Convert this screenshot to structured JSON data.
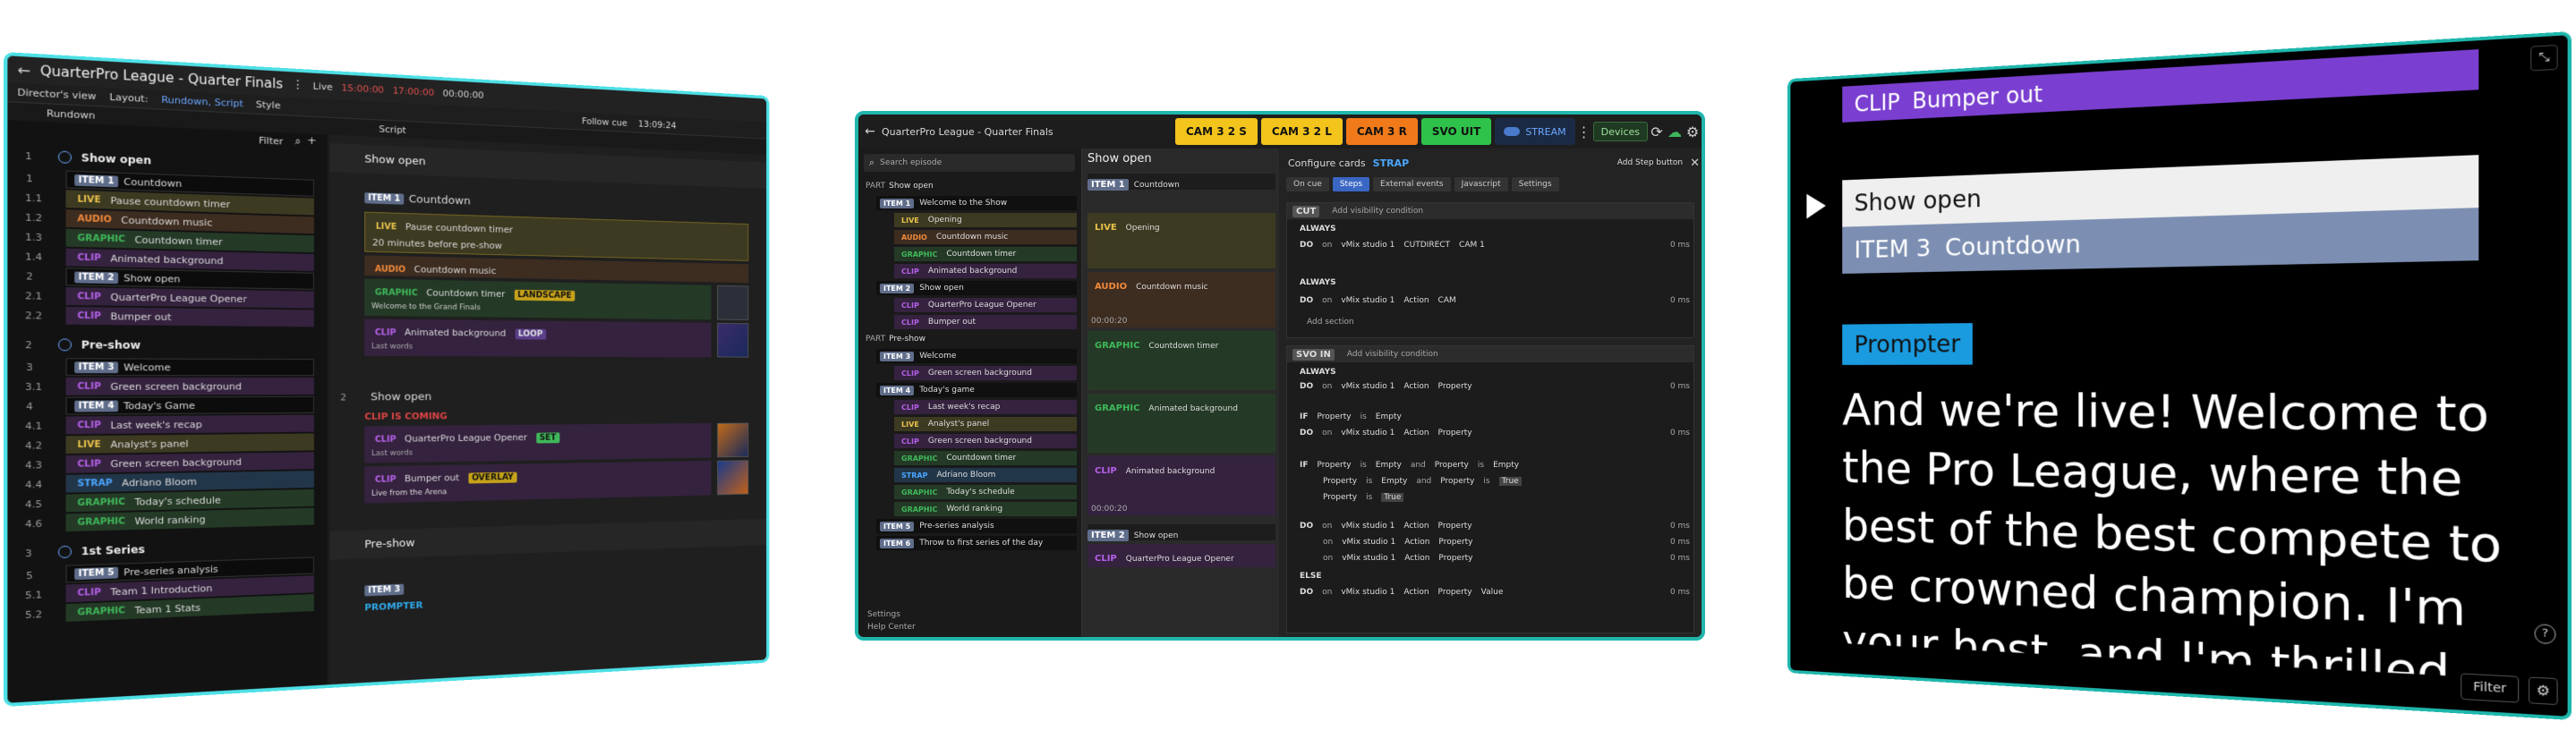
{
  "left": {
    "title": "QuarterPro League - Quarter Finals",
    "view_label": "Director's view",
    "layout_label": "Layout:",
    "layout_value": "Rundown, Script",
    "style_label": "Style",
    "live_label": "Live",
    "time1": "15:00:00",
    "time2": "17:00:00",
    "time3": "00:00:00",
    "rundown_tab": "Rundown",
    "script_tab": "Script",
    "filter_label": "Filter",
    "follow_label": "Follow cue",
    "clock": "13:09:24",
    "rundown": [
      {
        "num": "1",
        "kind": "part",
        "label": "Show open"
      },
      {
        "num": "1",
        "kind": "item",
        "tag": "ITEM 1",
        "label": "Countdown"
      },
      {
        "num": "1.1",
        "kind": "live",
        "tag": "LIVE",
        "label": "Pause countdown timer"
      },
      {
        "num": "1.2",
        "kind": "audio",
        "tag": "AUDIO",
        "label": "Countdown music"
      },
      {
        "num": "1.3",
        "kind": "graphic",
        "tag": "GRAPHIC",
        "label": "Countdown timer"
      },
      {
        "num": "1.4",
        "kind": "clip",
        "tag": "CLIP",
        "label": "Animated background"
      },
      {
        "num": "2",
        "kind": "item",
        "tag": "ITEM 2",
        "label": "Show open"
      },
      {
        "num": "2.1",
        "kind": "clip",
        "tag": "CLIP",
        "label": "QuarterPro League Opener"
      },
      {
        "num": "2.2",
        "kind": "clip",
        "tag": "CLIP",
        "label": "Bumper out"
      },
      {
        "num": "2",
        "kind": "part",
        "label": "Pre-show"
      },
      {
        "num": "3",
        "kind": "item",
        "tag": "ITEM 3",
        "label": "Welcome"
      },
      {
        "num": "3.1",
        "kind": "clip",
        "tag": "CLIP",
        "label": "Green screen background"
      },
      {
        "num": "4",
        "kind": "item",
        "tag": "ITEM 4",
        "label": "Today's Game"
      },
      {
        "num": "4.1",
        "kind": "clip",
        "tag": "CLIP",
        "label": "Last week's recap"
      },
      {
        "num": "4.2",
        "kind": "live",
        "tag": "LIVE",
        "label": "Analyst's panel"
      },
      {
        "num": "4.3",
        "kind": "clip",
        "tag": "CLIP",
        "label": "Green screen background"
      },
      {
        "num": "4.4",
        "kind": "strap",
        "tag": "STRAP",
        "label": "Adriano Bloom"
      },
      {
        "num": "4.5",
        "kind": "graphic",
        "tag": "GRAPHIC",
        "label": "Today's schedule"
      },
      {
        "num": "4.6",
        "kind": "graphic",
        "tag": "GRAPHIC",
        "label": "World ranking"
      },
      {
        "num": "3",
        "kind": "part",
        "label": "1st Series"
      },
      {
        "num": "5",
        "kind": "item",
        "tag": "ITEM 5",
        "label": "Pre-series analysis"
      },
      {
        "num": "5.1",
        "kind": "clip",
        "tag": "CLIP",
        "label": "Team 1 Introduction"
      },
      {
        "num": "5.2",
        "kind": "graphic",
        "tag": "GRAPHIC",
        "label": "Team 1 Stats"
      }
    ],
    "script": {
      "show_open": "Show open",
      "item1_tag": "ITEM 1",
      "item1_label": "Countdown",
      "live_tag": "LIVE",
      "live_text": "Pause countdown timer",
      "live_note": "20 minutes before pre-show",
      "audio_tag": "AUDIO",
      "audio_text": "Countdown music",
      "graphic_tag": "GRAPHIC",
      "graphic_text": "Countdown timer",
      "graphic_badge": "LANDSCAPE",
      "graphic_sub": "Welcome to the Grand Finals",
      "clip_tag": "CLIP",
      "clip_text": "Animated background",
      "clip_badge": "LOOP",
      "clip_sub": "Last words",
      "item2_num": "2",
      "item2_label": "Show open",
      "coming": "CLIP IS COMING",
      "opener_text": "QuarterPro League Opener",
      "opener_badge": "SET",
      "opener_sub": "Last words",
      "bumper_text": "Bumper out",
      "bumper_badge": "OVERLAY",
      "bumper_sub": "Live from the Arena",
      "preshow": "Pre-show",
      "item3_tag": "ITEM 3",
      "prompter": "PROMPTER"
    }
  },
  "mid": {
    "title": "QuarterPro League - Quarter Finals",
    "cams": [
      {
        "label": "CAM 3 2 S",
        "color": "#f2c41c"
      },
      {
        "label": "CAM 3 2 L",
        "color": "#f2c41c"
      },
      {
        "label": "CAM 3 R",
        "color": "#f07a1a"
      },
      {
        "label": "SVO UIT",
        "color": "#2fc24a"
      }
    ],
    "stream_label": "STREAM",
    "devices_label": "Devices",
    "search_placeholder": "Search episode",
    "tree": [
      {
        "kind": "part",
        "label": "Show open"
      },
      {
        "kind": "item",
        "tag": "ITEM 1",
        "label": "Welcome to the Show"
      },
      {
        "kind": "live",
        "tag": "LIVE",
        "label": "Opening"
      },
      {
        "kind": "audio",
        "tag": "AUDIO",
        "label": "Countdown music"
      },
      {
        "kind": "graphic",
        "tag": "GRAPHIC",
        "label": "Countdown timer"
      },
      {
        "kind": "clip",
        "tag": "CLIP",
        "label": "Animated background"
      },
      {
        "kind": "item",
        "tag": "ITEM 2",
        "label": "Show open"
      },
      {
        "kind": "clip",
        "tag": "CLIP",
        "label": "QuarterPro League Opener"
      },
      {
        "kind": "clip",
        "tag": "CLIP",
        "label": "Bumper out"
      },
      {
        "kind": "part",
        "label": "Pre-show"
      },
      {
        "kind": "item",
        "tag": "ITEM 3",
        "label": "Welcome"
      },
      {
        "kind": "clip",
        "tag": "CLIP",
        "label": "Green screen background"
      },
      {
        "kind": "item",
        "tag": "ITEM 4",
        "label": "Today's game"
      },
      {
        "kind": "clip",
        "tag": "CLIP",
        "label": "Last week's recap"
      },
      {
        "kind": "live",
        "tag": "LIVE",
        "label": "Analyst's panel"
      },
      {
        "kind": "clip",
        "tag": "CLIP",
        "label": "Green screen background"
      },
      {
        "kind": "graphic",
        "tag": "GRAPHIC",
        "label": "Countdown timer"
      },
      {
        "kind": "strap",
        "tag": "STRAP",
        "label": "Adriano Bloom"
      },
      {
        "kind": "graphic",
        "tag": "GRAPHIC",
        "label": "Today's schedule"
      },
      {
        "kind": "graphic",
        "tag": "GRAPHIC",
        "label": "World ranking"
      },
      {
        "kind": "item",
        "tag": "ITEM 5",
        "label": "Pre-series analysis"
      },
      {
        "kind": "item",
        "tag": "ITEM 6",
        "label": "Throw to first series of the day"
      }
    ],
    "settings_label": "Settings",
    "help_label": "Help Center",
    "script_header": "Show open",
    "script_item1_tag": "ITEM 1",
    "script_item1_label": "Countdown",
    "script_live": "Opening",
    "script_audio": "Countdown music",
    "script_time1": "00:00:20",
    "script_graphic1": "Countdown timer",
    "script_graphic2": "Animated background",
    "script_clip": "Animated background",
    "script_time2": "00:00:20",
    "script_item2_tag": "ITEM 2",
    "script_item2_label": "Show open",
    "script_clip2": "QuarterPro League Opener",
    "config_title": "Configure cards",
    "config_type": "STRAP",
    "add_step": "Add Step button",
    "tabs": [
      "On cue",
      "Steps",
      "External events",
      "Javascript",
      "Settings"
    ],
    "step1_badge": "CUT",
    "add_visibility": "Add visibility condition",
    "always": "ALWAYS",
    "do": "DO",
    "on": "on",
    "device1": "vMix studio 1",
    "action_cut": "CUTDIRECT",
    "cam_value": "CAM 1",
    "action": "Action",
    "cam_short": "CAM",
    "time_0ms": "0 ms",
    "add_section": "Add section",
    "step2_badge": "SVO IN",
    "if": "IF",
    "property": "Property",
    "is": "is",
    "empty": "Empty",
    "and": "and",
    "true_val": "True",
    "else": "ELSE",
    "value": "Value"
  },
  "right": {
    "clip_tag": "CLIP",
    "clip_label": "Bumper out",
    "show_open": "Show open",
    "item_tag": "ITEM 3",
    "item_label": "Countdown",
    "prompter_label": "Prompter",
    "lines": [
      "And we're live! Welcome to",
      "the Pro League, where the",
      "best of the best compete to",
      "be crowned champion. I'm",
      "your host, and I'm thrilled"
    ],
    "filter_label": "Filter"
  }
}
